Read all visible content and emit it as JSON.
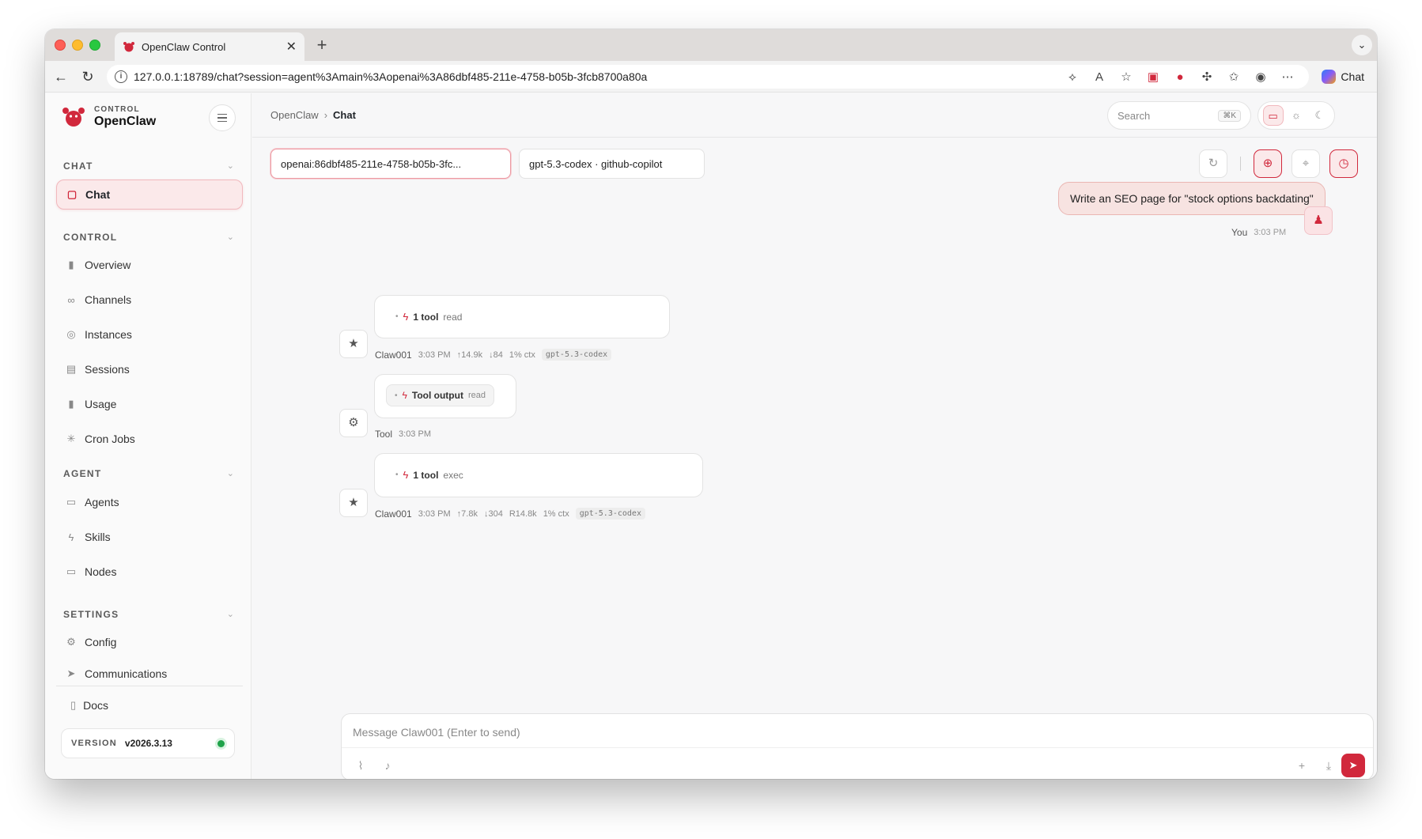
{
  "browser": {
    "tab_title": "OpenClaw Control",
    "url": "127.0.0.1:18789/chat?session=agent%3Amain%3Aopenai%3A86dbf485-211e-4758-b05b-3fcb8700a80a",
    "copilot_label": "Chat"
  },
  "sidebar": {
    "brand_small": "CONTROL",
    "brand_name": "OpenClaw",
    "sections": {
      "chat": "CHAT",
      "control": "CONTROL",
      "agent": "AGENT",
      "settings": "SETTINGS"
    },
    "items": {
      "chat": "Chat",
      "overview": "Overview",
      "channels": "Channels",
      "instances": "Instances",
      "sessions": "Sessions",
      "usage": "Usage",
      "cron": "Cron Jobs",
      "agents": "Agents",
      "skills": "Skills",
      "nodes": "Nodes",
      "config": "Config",
      "communications": "Communications"
    },
    "docs": "Docs",
    "version_label": "VERSION",
    "version": "v2026.3.13"
  },
  "topbar": {
    "crumb_root": "OpenClaw",
    "crumb_sep": "›",
    "crumb_current": "Chat",
    "search_placeholder": "Search",
    "search_kbd": "⌘K"
  },
  "session": {
    "session_label": "openai:86dbf485-211e-4758-b05b-3fc...",
    "model_label": "gpt-5.3-codex · github-copilot"
  },
  "messages": {
    "user": {
      "text": "Write an SEO page for \"stock options backdating\"",
      "who": "You",
      "time": "3:03 PM"
    },
    "m1": {
      "tool_count": "1 tool",
      "tool_name": "read",
      "who": "Claw001",
      "time": "3:03 PM",
      "up": "↑14.9k",
      "down": "↓84",
      "ctx": "1% ctx",
      "model": "gpt-5.3-codex"
    },
    "m2": {
      "label": "Tool output",
      "tool_name": "read",
      "who": "Tool",
      "time": "3:03 PM"
    },
    "m3": {
      "tool_count": "1 tool",
      "tool_name": "exec",
      "who": "Claw001",
      "time": "3:03 PM",
      "up": "↑7.8k",
      "down": "↓304",
      "r": "R14.8k",
      "ctx": "1% ctx",
      "model": "gpt-5.3-codex"
    }
  },
  "composer": {
    "placeholder": "Message Claw001 (Enter to send)"
  },
  "colors": {
    "accent": "#d1283c",
    "accent_soft": "#fbe9ea",
    "status_online": "#1fa34a"
  }
}
